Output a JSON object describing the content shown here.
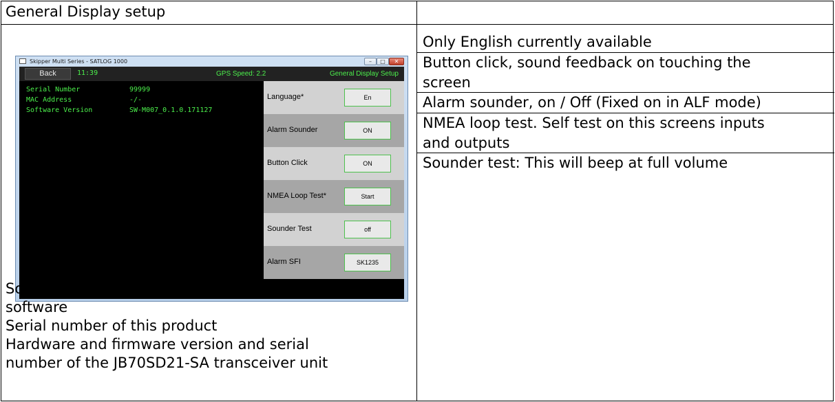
{
  "table": {
    "header": "General Display setup",
    "left_notes": [
      "Software version can be updated via Service",
      "software",
      "Serial number of this product",
      "Hardware and firmware version and serial",
      "number  of the JB70SD21-SA transceiver unit"
    ],
    "right_notes": [
      "Only English currently available",
      "Button click, sound feedback on touching the",
      "screen",
      "Alarm sounder, on / Off (Fixed on in ALF mode)",
      "NMEA loop test. Self test on this screens inputs",
      "and outputs",
      "Sounder test: This will beep at full volume"
    ]
  },
  "app": {
    "window_title": "Skipper Multi Series - SATLOG 1000",
    "window_buttons": {
      "minimize": "–",
      "maximize": "□",
      "close": "✕"
    },
    "back_label": "Back",
    "time": "11:39",
    "gps_speed": "GPS Speed: 2.2",
    "screen_title": "General Display Setup",
    "info": [
      {
        "label": "Serial Number",
        "value": "99999"
      },
      {
        "label": "MAC Address",
        "value": "-/-"
      },
      {
        "label": "Software Version",
        "value": "SW-M007_0.1.0.171127"
      }
    ],
    "settings": [
      {
        "label": "Language*",
        "value": "En"
      },
      {
        "label": "Alarm Sounder",
        "value": "ON"
      },
      {
        "label": "Button Click",
        "value": "ON"
      },
      {
        "label": "NMEA Loop Test*",
        "value": "Start"
      },
      {
        "label": "Sounder Test",
        "value": "off"
      },
      {
        "label": "Alarm SFI",
        "value": "SK1235"
      }
    ],
    "colors": {
      "text_green": "#4cf04c",
      "screen_bg": "#000000",
      "row_light": "#d2d2d2",
      "row_dark": "#a6a6a6"
    }
  }
}
